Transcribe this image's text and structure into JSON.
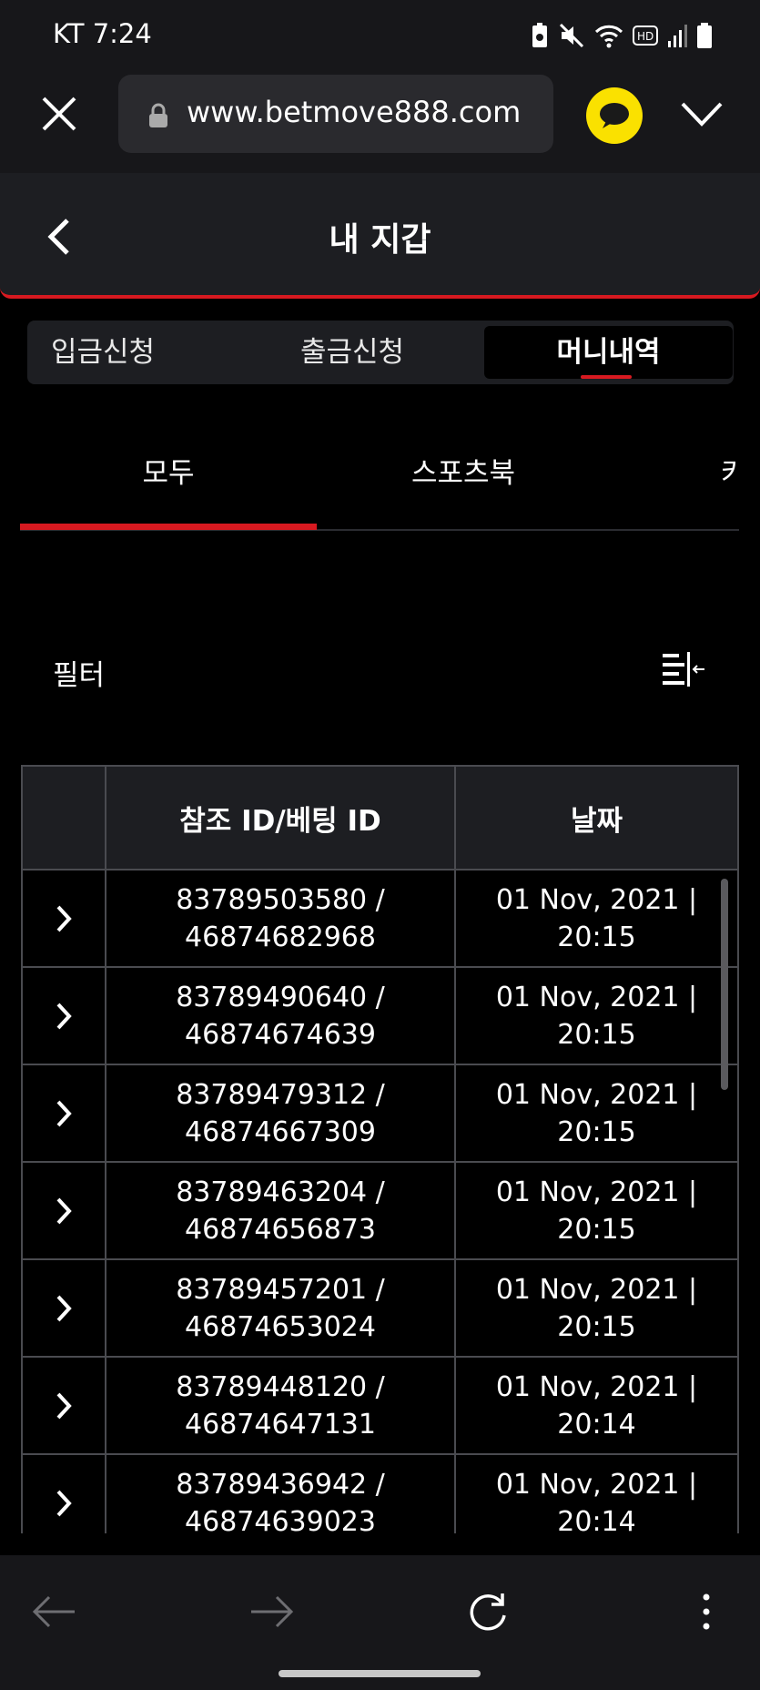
{
  "status_bar": {
    "carrier_time": "KT  7:24"
  },
  "browser": {
    "url": "www.betmove888.com"
  },
  "header": {
    "title": "내 지갑"
  },
  "wallet_tabs": [
    {
      "label": "입금신청"
    },
    {
      "label": "출금신청"
    },
    {
      "label": "머니내역",
      "active": true
    }
  ],
  "category_tabs": [
    {
      "label": "모두",
      "active": true
    },
    {
      "label": "스포츠북"
    },
    {
      "label": "카"
    }
  ],
  "filter": {
    "label": "필터"
  },
  "table": {
    "headers": [
      "",
      "참조 ID/베팅 ID",
      "날짜"
    ],
    "rows": [
      {
        "ref_id": "83789503580 /",
        "bet_id": "46874682968",
        "date": "01 Nov, 2021 |",
        "time": "20:15"
      },
      {
        "ref_id": "83789490640 /",
        "bet_id": "46874674639",
        "date": "01 Nov, 2021 |",
        "time": "20:15"
      },
      {
        "ref_id": "83789479312 /",
        "bet_id": "46874667309",
        "date": "01 Nov, 2021 |",
        "time": "20:15"
      },
      {
        "ref_id": "83789463204 /",
        "bet_id": "46874656873",
        "date": "01 Nov, 2021 |",
        "time": "20:15"
      },
      {
        "ref_id": "83789457201 /",
        "bet_id": "46874653024",
        "date": "01 Nov, 2021 |",
        "time": "20:15"
      },
      {
        "ref_id": "83789448120 /",
        "bet_id": "46874647131",
        "date": "01 Nov, 2021 |",
        "time": "20:14"
      },
      {
        "ref_id": "83789436942 /",
        "bet_id": "46874639023",
        "date": "01 Nov, 2021 |",
        "time": "20:14"
      }
    ]
  },
  "colors": {
    "accent": "#d71920",
    "kakao": "#fae100",
    "background": "#000000",
    "panel": "#1d1e22"
  }
}
